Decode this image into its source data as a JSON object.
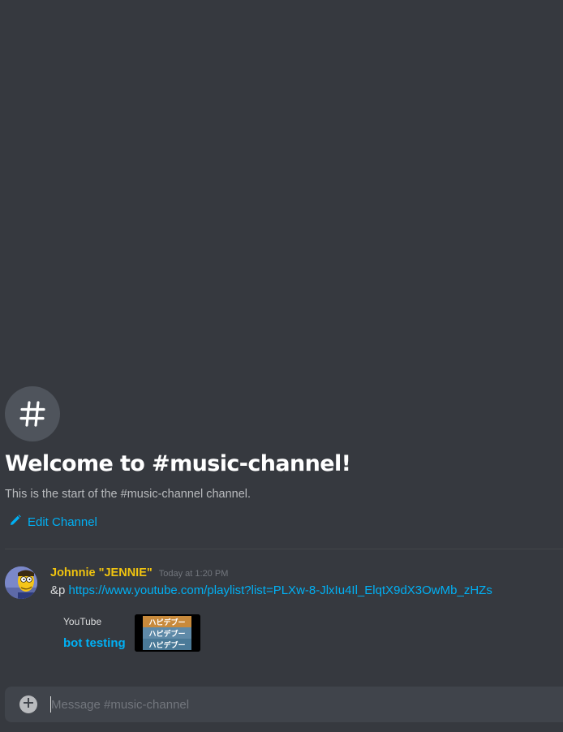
{
  "welcome": {
    "icon": "hash-icon",
    "title": "Welcome to #music-channel!",
    "subtitle": "This is the start of the #music-channel channel.",
    "edit_label": "Edit Channel"
  },
  "message": {
    "username": "Johnnie \"JENNIE\"",
    "timestamp": "Today at 1:20 PM",
    "command": "&p ",
    "link": "https://www.youtube.com/playlist?list=PLXw-8-JlxIu4Il_ElqtX9dX3OwMb_zHZs",
    "embed": {
      "provider": "YouTube",
      "title": "bot testing",
      "thumbnail_text": [
        "ハピデブー",
        "ハピデブー",
        "ハピデブー"
      ]
    }
  },
  "composer": {
    "placeholder": "Message #music-channel"
  },
  "colors": {
    "background": "#36393f",
    "username": "#f1c40f",
    "link": "#00b0f4",
    "composer": "#40444b"
  }
}
